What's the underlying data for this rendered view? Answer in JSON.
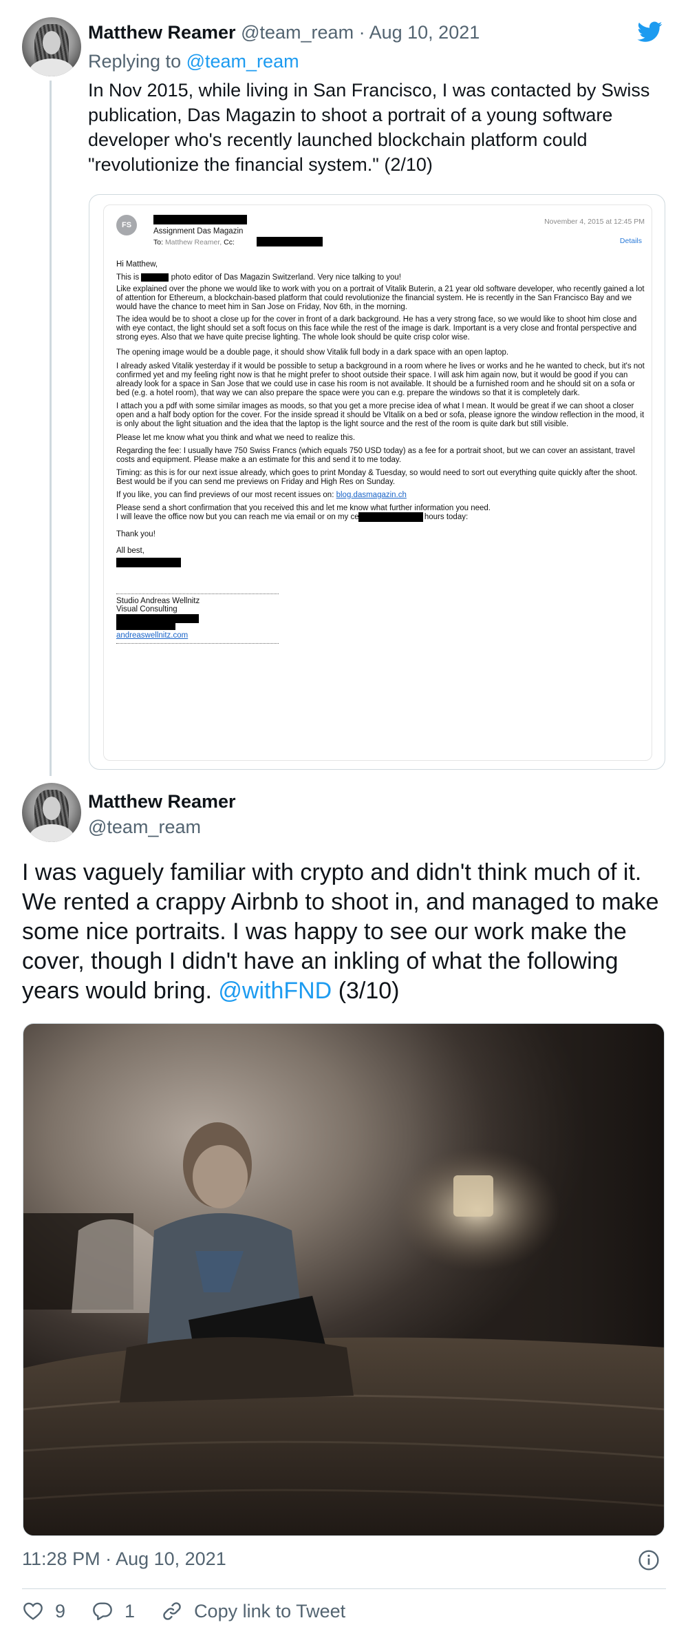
{
  "tweet1": {
    "display_name": "Matthew Reamer",
    "handle": "@team_ream",
    "separator": "·",
    "date": "Aug 10, 2021",
    "replying_prefix": "Replying to",
    "replying_handle": "@team_ream",
    "text": "In Nov 2015, while living in San Francisco, I was contacted by Swiss publication, Das Magazin to shoot a portrait of a young software developer who's recently launched blockchain platform could \"revolutionize the financial system.\"  (2/10)"
  },
  "email": {
    "avatar_initials": "FS",
    "subject": "Assignment Das Magazin",
    "to_label": "To:",
    "to_value": "Matthew Reamer,",
    "cc_label": "Cc:",
    "date": "November 4, 2015 at 12:45 PM",
    "details": "Details",
    "greeting": "Hi Matthew,",
    "intro_prefix": "This is",
    "intro_suffix": "photo editor of Das Magazin Switzerland. Very nice talking to you!",
    "para1": "Like explained over the phone we would like to work with you on a portrait of Vitalik Buterin, a 21 year old software developer, who recently gained a lot of attention for Ethereum, a blockchain-based platform that could revolutionize the financial system. He is recently in the San Francisco Bay and we would have the chance to meet him in San Jose on Friday, Nov 6th, in the morning.",
    "para2": "The idea would be to shoot a close up for the cover in front of a dark background. He has a very strong face, so we would like to shoot him close and with eye contact, the light should set a soft focus on this face while the rest of the image is dark. Important is a very close and frontal perspective and strong eyes. Also that we have quite precise lighting. The whole look should be quite crisp color wise.",
    "para3": "The opening image would be a double page, it should show Vitalik full body in a dark space with an open laptop.",
    "para4": "I already asked Vitalik yesterday if it would be possible to setup a background in a room where he lives or works and he he wanted to check, but it's not confirmed yet and my feeling right now is that he might prefer to shoot outside their space. I will ask him again now, but it would be good if you can already look for a space in San Jose that we could use in case his room is not available. It should be a furnished room and he should sit on a sofa or bed (e.g. a hotel room), that way we can also prepare the space were you can e.g. prepare the windows so that it is completely dark.",
    "para5": "I attach you a pdf with some similar images as moods, so that you get a more precise idea of what I mean. It would be great if we can shoot a closer open and a half body option for the cover. For the inside spread it should be VItalik on a bed or sofa, please ignore the window reflection in the mood, it is only about the light situation and the idea that the laptop is the light source and the rest of the room is quite dark but still visible.",
    "para6": "Please let me know what you think and what we need to realize this.",
    "para7": "Regarding the fee: I usually have 750 Swiss Francs (which equals 750 USD today) as a fee for a portrait shoot, but we can cover an assistant, travel costs and equipment. Please make a an estimate for this and send it to me today.",
    "para8": "Timing: as this is for our next issue already, which goes to print Monday & Tuesday, so would need to sort out everything quite quickly after the shoot. Best would be if you can send me previews on Friday and High Res on Sunday.",
    "para9_prefix": "If you like, you can find previews of our most recent issues on:",
    "para9_link": "blog.dasmagazin.ch",
    "para10a": "Please send a short confirmation that you received this and let me know what further information you need.",
    "para10b": "I will leave the office now but you can reach me via email or on my cell for ca. another 3 hours today:",
    "thanks": "Thank you!",
    "sign_off": "All best,",
    "sig_studio": "Studio Andreas Wellnitz",
    "sig_role": "Visual Consulting",
    "sig_link": "andreaswellnitz.com"
  },
  "tweet2": {
    "display_name": "Matthew Reamer",
    "handle": "@team_ream",
    "text_main": "I was vaguely familiar with crypto and didn't think much of it. We rented a crappy Airbnb to shoot in, and managed to make some nice portraits. I was happy to see our work make the cover, though I didn't have an inkling of what the following years would bring.",
    "mention": "@withFND",
    "text_suffix": "(3/10)",
    "timestamp": "11:28 PM · Aug 10, 2021",
    "likes": "9",
    "replies": "1",
    "copy_link": "Copy link to Tweet"
  },
  "colors": {
    "accent": "#1d9bf0",
    "muted": "#536471",
    "border": "#cfd9de"
  },
  "icons": [
    "twitter-bird-icon",
    "info-icon",
    "heart-icon",
    "reply-icon",
    "link-icon"
  ]
}
